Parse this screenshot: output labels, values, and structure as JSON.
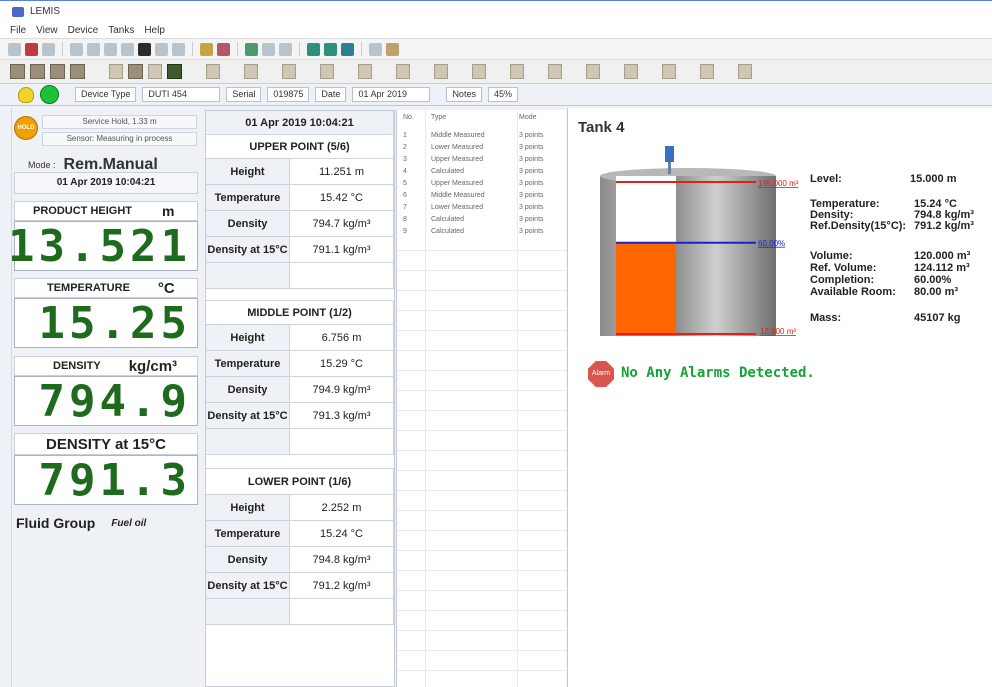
{
  "window": {
    "title": "LEMIS"
  },
  "menu": [
    "File",
    "View",
    "Device",
    "Tanks",
    "Help"
  ],
  "infobar": {
    "device_type_label": "Device Type",
    "device_type": "DUTI 454",
    "serial_label": "Serial",
    "serial": "019875",
    "date_label": "Date",
    "date": "01 Apr 2019",
    "notes_label": "Notes",
    "notes": "45%"
  },
  "left": {
    "hold": "HOLD",
    "service_line1": "Service Hold, 1.33 m",
    "service_line2": "Sensor: Measuring in process",
    "mode_label": "Mode :",
    "mode_value": "Rem.Manual",
    "timestamp": "01 Apr 2019 10:04:21",
    "product_height": {
      "label": "PRODUCT HEIGHT",
      "unit": "m",
      "value": "13.521"
    },
    "temperature": {
      "label": "TEMPERATURE",
      "unit": "°C",
      "value": "15.25"
    },
    "density": {
      "label": "DENSITY",
      "unit": "kg/cm³",
      "value": "794.9"
    },
    "density15": {
      "label": "DENSITY at 15°C",
      "value": "791.3"
    },
    "fluid_group_label": "Fluid Group",
    "fluid_group_value": "Fuel oil"
  },
  "points": {
    "timestamp": "01 Apr 2019 10:04:21",
    "upper": {
      "title": "UPPER POINT (5/6)",
      "rows": [
        {
          "label": "Height",
          "value": "11.251 m"
        },
        {
          "label": "Temperature",
          "value": "15.42 °C"
        },
        {
          "label": "Density",
          "value": "794.7 kg/m³"
        },
        {
          "label": "Density at 15°C",
          "value": "791.1 kg/m³"
        }
      ]
    },
    "middle": {
      "title": "MIDDLE  POINT (1/2)",
      "rows": [
        {
          "label": "Height",
          "value": "6.756 m"
        },
        {
          "label": "Temperature",
          "value": "15.29 °C"
        },
        {
          "label": "Density",
          "value": "794.9 kg/m³"
        },
        {
          "label": "Density at 15°C",
          "value": "791.3 kg/m³"
        }
      ]
    },
    "lower": {
      "title": "LOWER POINT (1/6)",
      "rows": [
        {
          "label": "Height",
          "value": "2.252 m"
        },
        {
          "label": "Temperature",
          "value": "15.24 °C"
        },
        {
          "label": "Density",
          "value": "794.8 kg/m³"
        },
        {
          "label": "Density at 15°C",
          "value": "791.2 kg/m³"
        }
      ]
    }
  },
  "list": {
    "headers": [
      "No.",
      "Type",
      "Mode"
    ],
    "rows": [
      [
        "1",
        "Middle Measured",
        "3 points"
      ],
      [
        "2",
        "Lower Measured",
        "3 points"
      ],
      [
        "3",
        "Upper Measured",
        "3 points"
      ],
      [
        "4",
        "Calculated",
        "3 points"
      ],
      [
        "5",
        "Upper Measured",
        "3 points"
      ],
      [
        "6",
        "Middle Measured",
        "3 points"
      ],
      [
        "7",
        "Lower Measured",
        "3 points"
      ],
      [
        "8",
        "Calculated",
        "3 points"
      ],
      [
        "9",
        "Calculated",
        "3 points"
      ]
    ]
  },
  "tank": {
    "title": "Tank 4",
    "top_marker": "195.000 m³",
    "mid_marker": "60.00%",
    "bottom_marker": "12.000 m³",
    "fill_fraction": 0.6,
    "colors": {
      "fill": "#ff6600",
      "red_line": "#e0201a",
      "blue_line": "#1a23c8"
    },
    "stats": {
      "level_label": "Level:",
      "level": "15.000 m",
      "temperature_label": "Temperature:",
      "temperature": "15.24 °C",
      "density_label": "Density:",
      "density": "794.8 kg/m³",
      "refdensity_label": "Ref.Density(15°C):",
      "refdensity": "791.2 kg/m³",
      "volume_label": "Volume:",
      "volume": "120.000 m³",
      "refvolume_label": "Ref. Volume:",
      "refvolume": "124.112 m³",
      "completion_label": "Completion:",
      "completion": "60.00%",
      "available_label": "Available Room:",
      "available": "80.00 m³",
      "mass_label": "Mass:",
      "mass": "45107 kg"
    },
    "alarm_icon_text": "Alarm",
    "alarm_message": "No Any Alarms Detected."
  }
}
